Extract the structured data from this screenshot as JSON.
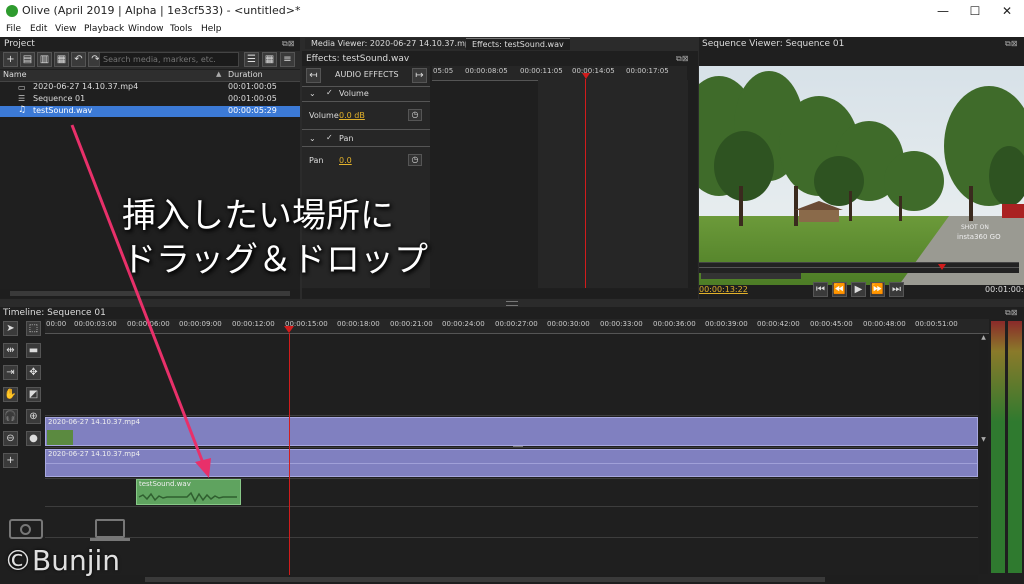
{
  "window": {
    "title": "Olive (April 2019 | Alpha | 1e3cf533) - <untitled>*",
    "minimize": "—",
    "maximize": "☐",
    "close": "✕"
  },
  "menu": [
    "File",
    "Edit",
    "View",
    "Playback",
    "Window",
    "Tools",
    "Help"
  ],
  "project": {
    "header": "Project",
    "search_placeholder": "Search media, markers, etc.",
    "col_name": "Name",
    "col_duration": "Duration",
    "items": [
      {
        "name": "2020-06-27 14.10.37.mp4",
        "duration": "00:01:00:05"
      },
      {
        "name": "Sequence 01",
        "duration": "00:01:00:05"
      },
      {
        "name": "testSound.wav",
        "duration": "00:00:05:29"
      }
    ]
  },
  "tabs": {
    "media_viewer": "Media Viewer: 2020-06-27 14.10.37.mp4",
    "effects": "Effects: testSound.wav"
  },
  "effects": {
    "header": "Effects: testSound.wav",
    "section_label": "AUDIO EFFECTS",
    "volume_group": "Volume",
    "volume_label": "Volume",
    "volume_value": "0.0 dB",
    "pan_group": "Pan",
    "pan_label": "Pan",
    "pan_value": "0.0",
    "ruler": [
      "05:05",
      "00:00:08:05",
      "00:00:11:05",
      "00:00:14:05",
      "00:00:17:05"
    ]
  },
  "sequence_viewer": {
    "header": "Sequence Viewer: Sequence 01",
    "timecode": "00:00:13:22",
    "end_timecode": "00:01:00:05",
    "watermark_top": "SHOT ON",
    "watermark_bottom": "insta360 GO"
  },
  "timeline": {
    "header": "Timeline: Sequence 01",
    "ruler": [
      "00:00",
      "00:00:03:00",
      "00:00:06:00",
      "00:00:09:00",
      "00:00:12:00",
      "00:00:15:00",
      "00:00:18:00",
      "00:00:21:00",
      "00:00:24:00",
      "00:00:27:00",
      "00:00:30:00",
      "00:00:33:00",
      "00:00:36:00",
      "00:00:39:00",
      "00:00:42:00",
      "00:00:45:00",
      "00:00:48:00",
      "00:00:51:00"
    ],
    "video_clip": "2020-06-27 14.10.37.mp4",
    "audio_clip": "2020-06-27 14.10.37.mp4",
    "drag_clip": "testSound.wav"
  },
  "annotation": {
    "line1": "挿入したい場所に",
    "line2": "ドラッグ＆ドロップ"
  },
  "credit": "©Bunjin",
  "colors": {
    "accent": "#3c7ad6",
    "clip_video": "#8080c0",
    "clip_audio_drag": "#5fa35f",
    "playhead": "#d11c1c",
    "arrow": "#e8306a"
  }
}
